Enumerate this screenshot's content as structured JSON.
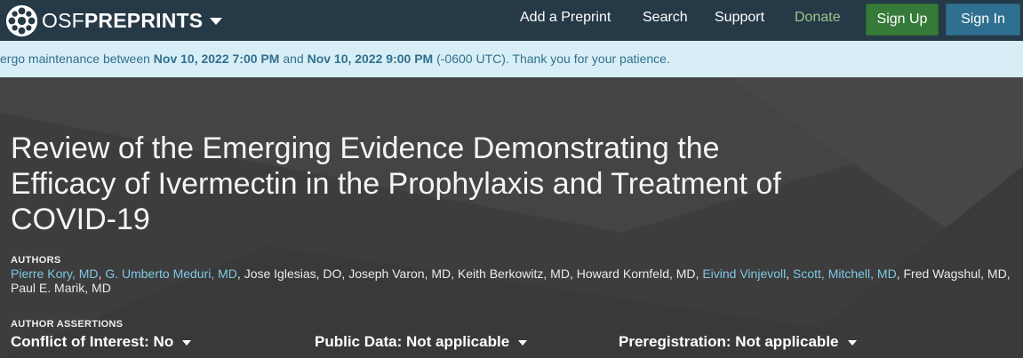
{
  "navbar": {
    "brand": {
      "prefix": "OSF",
      "name": "PREPRINTS"
    },
    "links": {
      "add_preprint": "Add a Preprint",
      "search": "Search",
      "support": "Support",
      "donate": "Donate"
    },
    "buttons": {
      "sign_up": "Sign Up",
      "sign_in": "Sign In"
    },
    "colors": {
      "background": "#263947",
      "donate": "#9ac78d",
      "sign_up": "#357a38",
      "sign_in": "#2f6f8f"
    }
  },
  "maintenance": {
    "prefix": "ergo maintenance between ",
    "start": "Nov 10, 2022 7:00 PM",
    "middle": " and ",
    "end": "Nov 10, 2022 9:00 PM",
    "suffix": " (-0600 UTC). Thank you for your patience."
  },
  "preprint": {
    "title": "Review of the Emerging Evidence Demonstrating the Efficacy of Ivermectin in the Prophylaxis and Treatment of COVID-19",
    "authors_label": "AUTHORS",
    "authors": [
      {
        "name": "Pierre Kory, MD",
        "linked": true
      },
      {
        "name": "G. Umberto Meduri, MD",
        "linked": true
      },
      {
        "name": "Jose Iglesias, DO",
        "linked": false
      },
      {
        "name": "Joseph Varon, MD",
        "linked": false
      },
      {
        "name": "Keith Berkowitz, MD",
        "linked": false
      },
      {
        "name": "Howard Kornfeld, MD",
        "linked": false
      },
      {
        "name": "Eivind Vinjevoll",
        "linked": true
      },
      {
        "name": "Scott, Mitchell, MD",
        "linked": true
      },
      {
        "name": "Fred Wagshul, MD",
        "linked": false
      },
      {
        "name": "Paul E. Marik, MD",
        "linked": false
      }
    ],
    "assertions_label": "AUTHOR ASSERTIONS",
    "assertions": {
      "conflict": "Conflict of Interest: No",
      "public_data": "Public Data: Not applicable",
      "preregistration": "Preregistration: Not applicable"
    },
    "colors": {
      "author_link": "#7fc7e3",
      "hero_background": "#3d3d3d",
      "banner_background": "#d8eef6",
      "banner_text": "#31708f"
    }
  }
}
